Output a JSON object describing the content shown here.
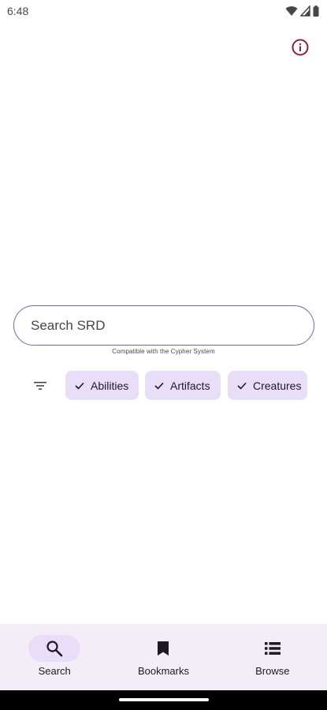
{
  "status_bar": {
    "time": "6:48",
    "icons": [
      "wifi-icon",
      "cellular-icon",
      "battery-icon"
    ]
  },
  "header": {
    "info_icon": "info-icon"
  },
  "search": {
    "placeholder": "Search SRD",
    "value": "",
    "compat_note": "Compatible with the Cypher System"
  },
  "filters": {
    "filter_icon": "filter-list-icon",
    "chips": [
      {
        "label": "Abilities",
        "selected": true
      },
      {
        "label": "Artifacts",
        "selected": true
      },
      {
        "label": "Creatures",
        "selected": true
      }
    ]
  },
  "bottom_nav": {
    "items": [
      {
        "label": "Search",
        "icon": "search-icon",
        "active": true
      },
      {
        "label": "Bookmarks",
        "icon": "bookmark-icon",
        "active": false
      },
      {
        "label": "Browse",
        "icon": "list-icon",
        "active": false
      }
    ]
  },
  "colors": {
    "accent": "#8c1d40",
    "chip_bg": "#e8def8",
    "nav_bg": "#f3edf7",
    "outline": "#6f6aa3"
  }
}
